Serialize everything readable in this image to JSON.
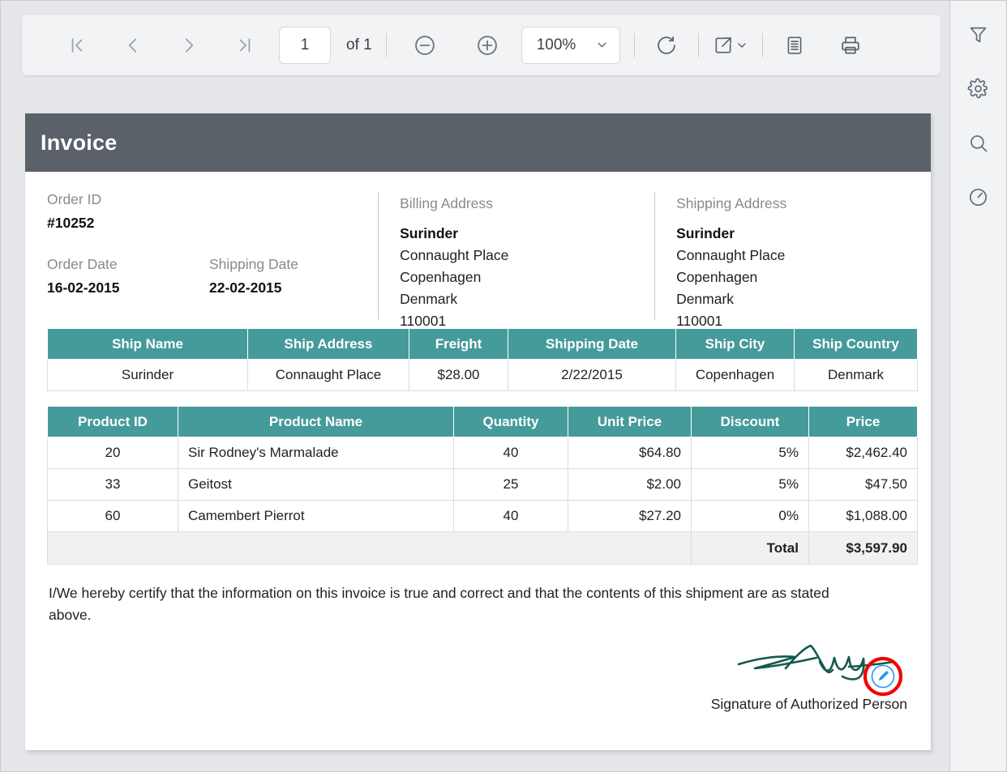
{
  "toolbar": {
    "first_page_label": "first-page",
    "prev_page_label": "previous-page",
    "next_page_label": "next-page",
    "last_page_label": "last-page",
    "page_number": "1",
    "page_count_label": "of 1",
    "zoom_out_label": "zoom-out",
    "zoom_in_label": "zoom-in",
    "zoom_value": "100%",
    "refresh_label": "refresh",
    "export_label": "export",
    "toc_label": "document-map",
    "print_label": "print"
  },
  "sidebar": {
    "items": [
      {
        "name": "filter-icon",
        "tooltip": "Parameters"
      },
      {
        "name": "gear-icon",
        "tooltip": "Settings"
      },
      {
        "name": "search-icon",
        "tooltip": "Search"
      },
      {
        "name": "gauge-icon",
        "tooltip": "Performance"
      }
    ]
  },
  "invoice": {
    "title": "Invoice",
    "order_id_label": "Order ID",
    "order_id_value": "#10252",
    "order_date_label": "Order Date",
    "order_date_value": "16-02-2015",
    "shipping_date_label": "Shipping Date",
    "shipping_date_value": "22-02-2015",
    "billing": {
      "label": "Billing Address",
      "name": "Surinder",
      "street": "Connaught Place",
      "city": "Copenhagen",
      "country": "Denmark",
      "postal": "110001"
    },
    "shipping": {
      "label": "Shipping Address",
      "name": "Surinder",
      "street": "Connaught Place",
      "city": "Copenhagen",
      "country": "Denmark",
      "postal": "110001"
    },
    "ship_table": {
      "headers": [
        "Ship Name",
        "Ship Address",
        "Freight",
        "Shipping Date",
        "Ship City",
        "Ship Country"
      ],
      "row": [
        "Surinder",
        "Connaught Place",
        "$28.00",
        "2/22/2015",
        "Copenhagen",
        "Denmark"
      ]
    },
    "product_table": {
      "headers": [
        "Product ID",
        "Product Name",
        "Quantity",
        "Unit Price",
        "Discount",
        "Price"
      ],
      "rows": [
        [
          "20",
          "Sir Rodney's Marmalade",
          "40",
          "$64.80",
          "5%",
          "$2,462.40"
        ],
        [
          "33",
          "Geitost",
          "25",
          "$2.00",
          "5%",
          "$47.50"
        ],
        [
          "60",
          "Camembert Pierrot",
          "40",
          "$27.20",
          "0%",
          "$1,088.00"
        ]
      ],
      "total_label": "Total",
      "total_value": "$3,597.90"
    },
    "certification": "I/We hereby certify that the information on this invoice is true and correct and that the contents of this shipment are as stated above.",
    "signature_caption": "Signature of Authorized Person",
    "signature_edit_icon": "pencil-icon"
  },
  "colors": {
    "banner": "#5a6169",
    "table_header": "#459b9a",
    "signature_ink": "#14594f",
    "annotation_ring": "#f50000",
    "edit_icon": "#2196f3",
    "page_background": "#e6e7ea",
    "toolbar_background": "#f2f3f5"
  }
}
